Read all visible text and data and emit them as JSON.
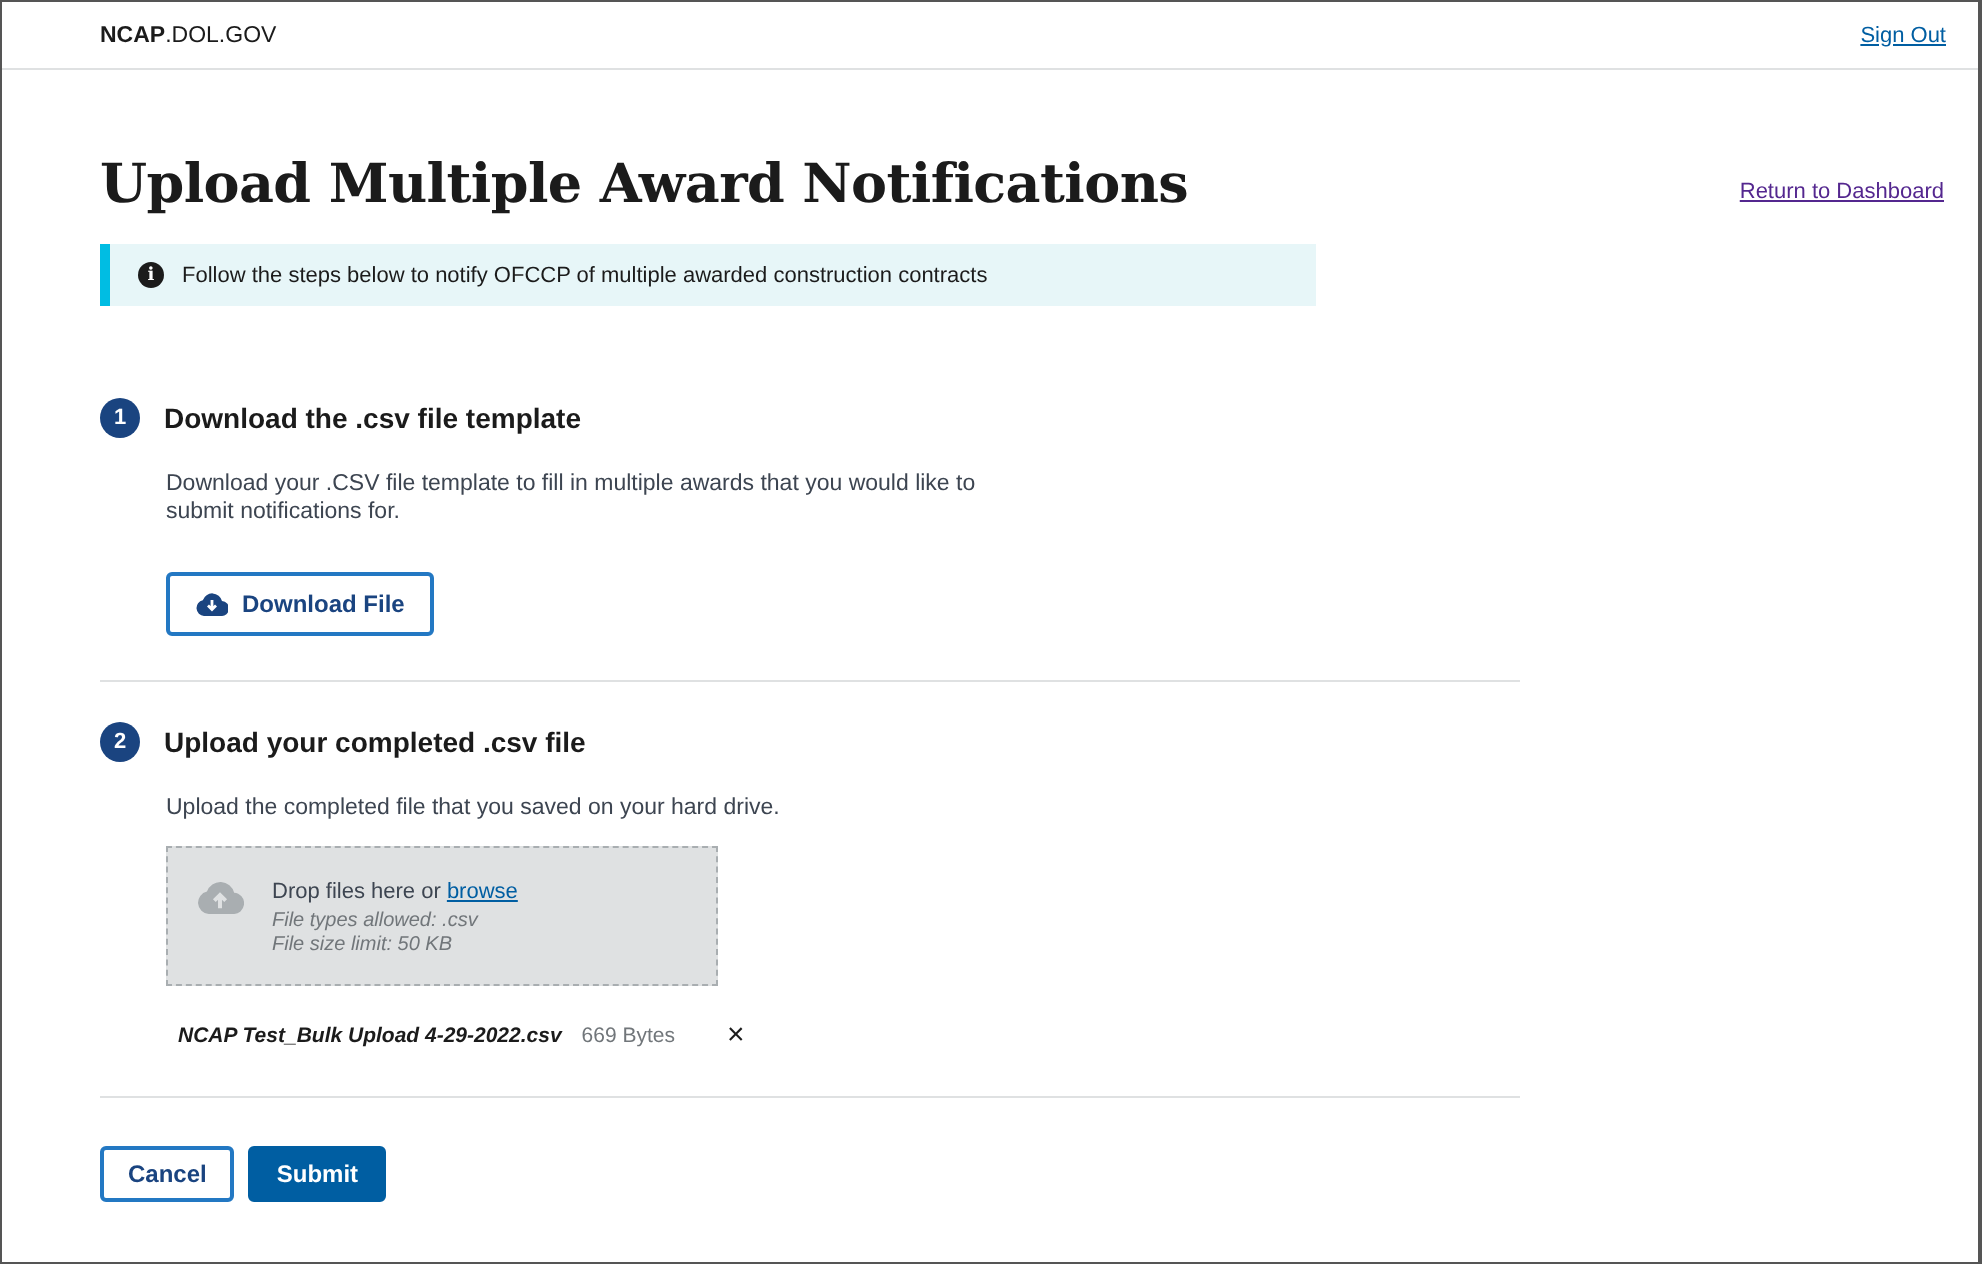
{
  "header": {
    "site": "**NCAP**.DOL.GOV",
    "sign_out": "Sign Out"
  },
  "title": "Upload Multiple Award Notifications",
  "return_link": "Return to Dashboard",
  "alert": {
    "icon": "i",
    "text": "Follow the steps below to notify OFCCP of multiple awarded construction contracts"
  },
  "steps": [
    {
      "kind": "download",
      "number": "1",
      "heading": "Download the .csv file template",
      "description": "Download your .CSV file template to fill in multiple awards that you would like to submit notifications for.",
      "button": "Download File"
    },
    {
      "kind": "upload",
      "number": "2",
      "heading": "Upload your completed .csv file",
      "description": "Upload the completed file that you saved on your hard drive.",
      "dropzone": {
        "prompt": "Drop files here or",
        "link": "browse",
        "types": "File types allowed: .csv",
        "limit": "File size limit: 50 KB"
      },
      "files": [
        {
          "name": "NCAP Test_Bulk Upload 4-29-2022.csv",
          "size": "669 Bytes",
          "remove": "×"
        }
      ]
    }
  ],
  "actions": [
    {
      "label": "Cancel",
      "kind": "outline"
    },
    {
      "label": "Submit",
      "kind": "primary"
    }
  ]
}
